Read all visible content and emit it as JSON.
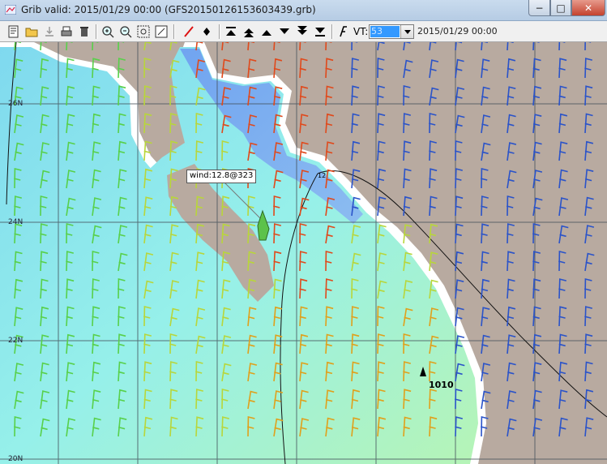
{
  "window": {
    "title": "Grib valid: 2015/01/29 00:00 (GFS20150126153603439.grb)",
    "minimize_label": "−",
    "maximize_label": "□",
    "close_label": "✕"
  },
  "toolbar": {
    "vt_label": "VT:",
    "vt_value": "53",
    "valid_time": "2015/01/29 00:00",
    "icons": [
      "open-grib-icon",
      "open-folder-icon",
      "download-icon",
      "print-icon",
      "delete-icon",
      "zoom-in-icon",
      "zoom-out-icon",
      "zoom-rect-icon",
      "zoom-fit-icon",
      "draw-line-icon",
      "waypoint-icon",
      "first-frame-icon",
      "fast-back-icon",
      "step-back-icon",
      "step-forward-icon",
      "fast-forward-icon",
      "last-frame-icon",
      "font-icon"
    ]
  },
  "map": {
    "lat_labels": [
      "26N",
      "24N",
      "22N",
      "20N"
    ],
    "tooltip": "wind:12.8@323",
    "pressure_value": "1010",
    "isobar_value": "12",
    "colors": {
      "land": "#b8aaa0",
      "coast": "#ffffff",
      "sea": "#8fe6ee",
      "grid": "#44505a",
      "wind_low": "#2a53c9",
      "wind_mid": "#58d04a",
      "wind_high": "#e0491b",
      "boat": "#5cc24a"
    }
  }
}
